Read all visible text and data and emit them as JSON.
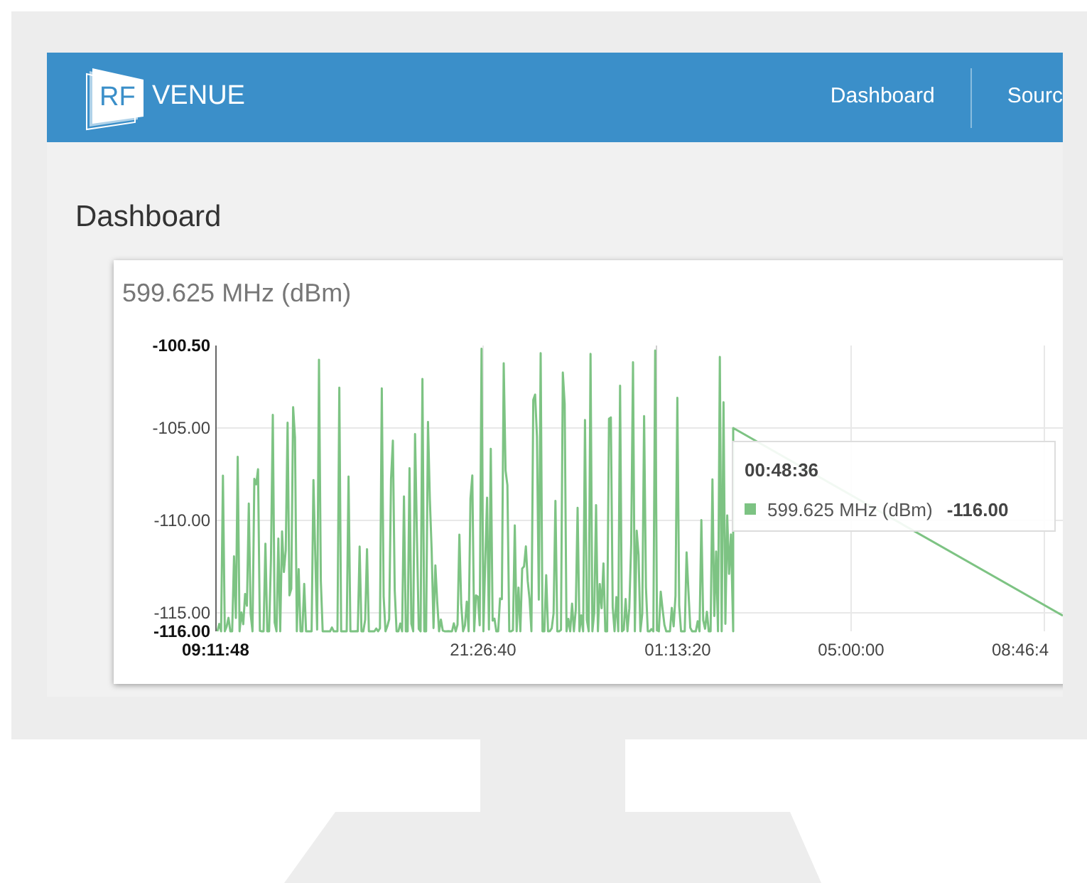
{
  "navbar": {
    "logo": {
      "mark_text": "RF",
      "name": "VENUE"
    },
    "links": [
      {
        "label": "Dashboard"
      },
      {
        "label": "Sourc"
      }
    ]
  },
  "page_title": "Dashboard",
  "chart_card": {
    "title": "599.625 MHz (dBm)",
    "y_axis_labels": [
      {
        "label": "-100.50",
        "bold": true
      },
      {
        "label": "-105.00",
        "bold": false
      },
      {
        "label": "-110.00",
        "bold": false
      },
      {
        "label": "-115.00",
        "bold": false
      },
      {
        "label": "-116.00",
        "bold": true
      }
    ],
    "x_axis_labels": [
      {
        "label": "09:11:48",
        "bold": true
      },
      {
        "label": "21:26:40",
        "bold": false
      },
      {
        "label": "01:13:20",
        "bold": false
      },
      {
        "label": "05:00:00",
        "bold": false
      },
      {
        "label": "08:46:4",
        "bold": false
      }
    ],
    "tooltip": {
      "time": "00:48:36",
      "series": "599.625 MHz (dBm)",
      "value": "-116.00",
      "color": "#7dc383"
    }
  }
}
